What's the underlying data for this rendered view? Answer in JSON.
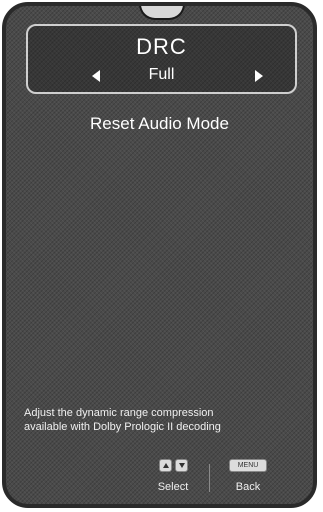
{
  "osd": {
    "setting": {
      "title": "DRC",
      "value": "Full",
      "left_icon": "arrow-left-icon",
      "right_icon": "arrow-right-icon"
    },
    "menu_items": [
      {
        "label": "Reset Audio Mode"
      }
    ],
    "help": {
      "line1": "Adjust the dynamic range compression",
      "line2": "available with Dolby Prologic II decoding"
    },
    "buttons": {
      "select": {
        "label": "Select",
        "icons": [
          "arrow-up-key-icon",
          "arrow-down-key-icon"
        ]
      },
      "back": {
        "label": "Back",
        "key_text": "MENU"
      }
    },
    "colors": {
      "background": "#4a4a4a",
      "text": "#ffffff",
      "frame_border": "#2a2a2a"
    }
  }
}
